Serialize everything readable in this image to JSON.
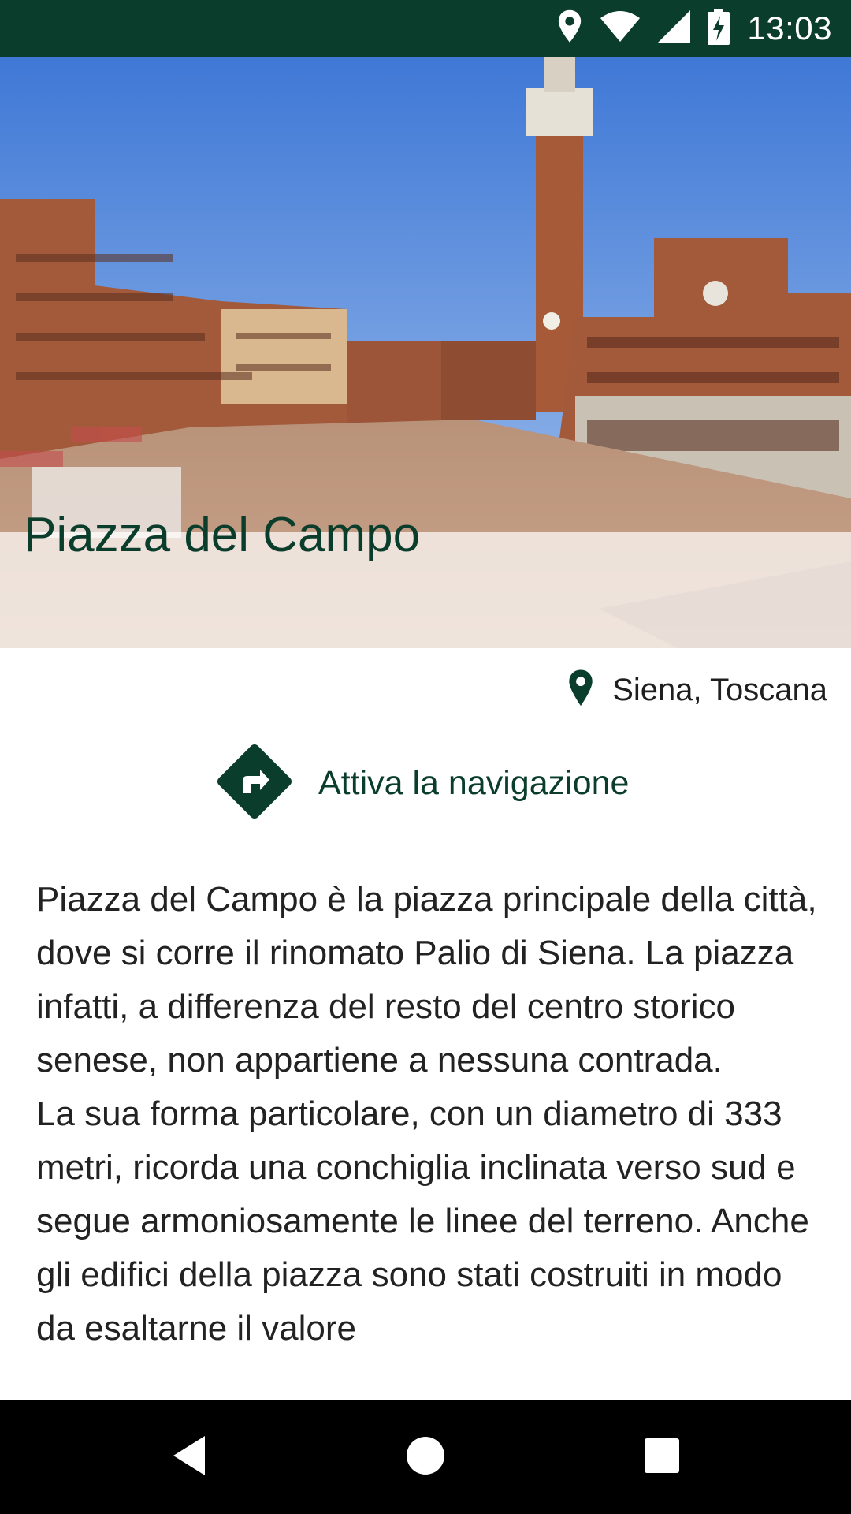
{
  "status_bar": {
    "time": "13:03",
    "background": "#0b3d2c",
    "icons": [
      "location-icon",
      "wifi-icon",
      "cell-signal-icon",
      "battery-charging-icon"
    ]
  },
  "hero": {
    "image": "photo of Piazza del Campo with Torre del Mangia",
    "title": "Piazza del Campo"
  },
  "location": {
    "icon": "map-pin-icon",
    "text": "Siena, Toscana"
  },
  "navigation": {
    "icon": "directions-icon",
    "label": "Attiva la navigazione"
  },
  "description": {
    "paragraphs": [
      "Piazza del Campo è la piazza principale della città, dove si corre il rinomato Palio di Siena. La piazza infatti, a differenza del resto del centro storico senese, non appartiene a nessuna contrada.",
      "La sua forma particolare, con un diametro di 333 metri, ricorda una conchiglia inclinata verso sud e segue armoniosamente le linee del terreno. Anche gli edifici della piazza sono stati costruiti in modo da esaltarne il valore"
    ]
  },
  "system_nav": {
    "buttons": [
      "back-icon",
      "home-icon",
      "recents-icon"
    ]
  },
  "colors": {
    "primary": "#0b3d2c",
    "text": "#222222",
    "nav_bar": "#000000"
  }
}
